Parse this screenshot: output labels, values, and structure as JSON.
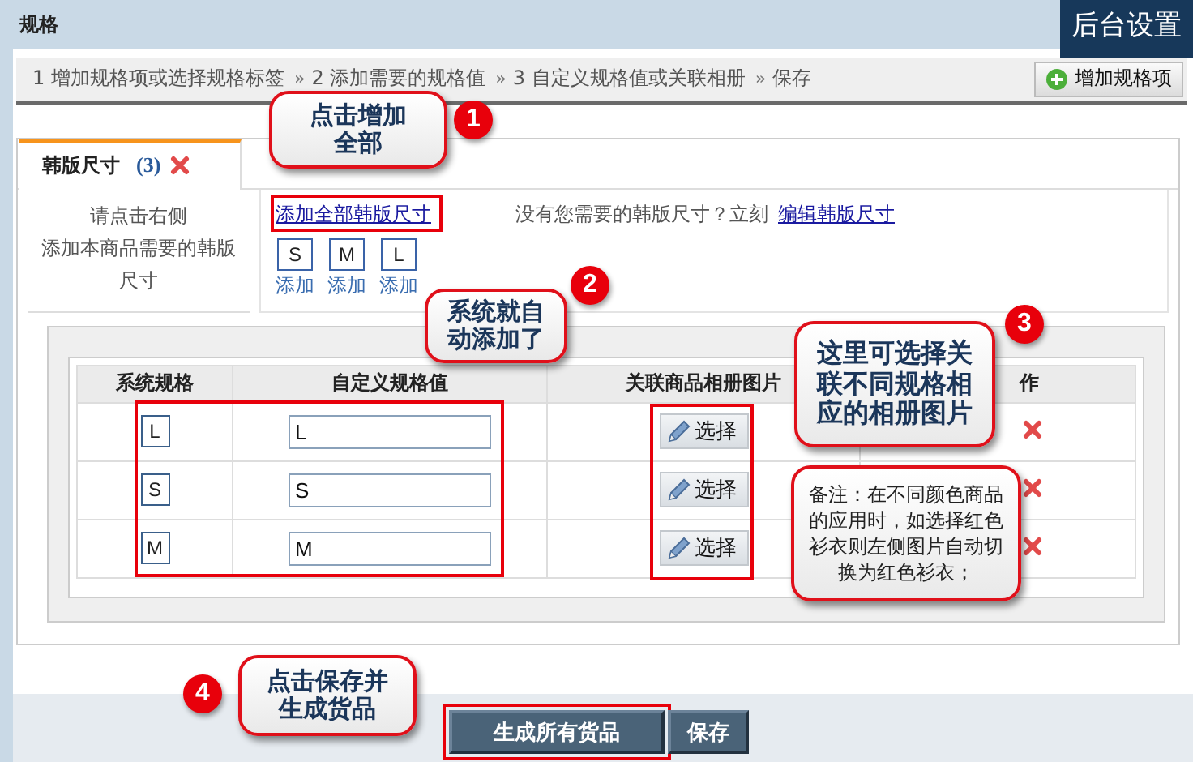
{
  "header": {
    "title": "规格",
    "settings": "后台设置"
  },
  "steps": {
    "items": [
      "1 增加规格项或选择规格标签",
      "2 添加需要的规格值",
      "3 自定义规格值或关联相册",
      "保存"
    ],
    "separator": "»"
  },
  "add_spec_button": "增加规格项",
  "spec_tabs": [
    {
      "label": "韩版尺寸",
      "count": "(3)",
      "selected": true
    }
  ],
  "hint": [
    "请点击右侧",
    "添加本商品需要的韩版",
    "尺寸"
  ],
  "add_all_link": "添加全部韩版尺寸",
  "size_options": [
    {
      "label": "S",
      "action": "添加"
    },
    {
      "label": "M",
      "action": "添加"
    },
    {
      "label": "L",
      "action": "添加"
    }
  ],
  "missing_text": "没有您需要的韩版尺寸？立刻",
  "edit_link": "编辑韩版尺寸",
  "table": {
    "columns": [
      "系统规格",
      "自定义规格值",
      "关联商品相册图片",
      "作"
    ],
    "rows": [
      {
        "system": "L",
        "value": "L",
        "select": "选择"
      },
      {
        "system": "S",
        "value": "S",
        "select": "选择"
      },
      {
        "system": "M",
        "value": "M",
        "select": "选择"
      }
    ]
  },
  "buttons": [
    {
      "label": "生成所有货品",
      "highlighted": true
    },
    {
      "label": "保存",
      "highlighted": false
    }
  ],
  "callouts": [
    {
      "kind": "step",
      "number": "1",
      "text": "点击增加全部"
    },
    {
      "kind": "step",
      "number": "2",
      "text": "系统就自动添加了"
    },
    {
      "kind": "step",
      "number": "3",
      "text": "这里可选择关联不同规格相应的相册图片"
    },
    {
      "kind": "note",
      "text": "备注：在不同颜色商品的应用时，如选择红色衫衣则左侧图片自动切换为红色衫衣；"
    },
    {
      "kind": "step",
      "number": "4",
      "text": "点击保存并生成货品"
    }
  ]
}
